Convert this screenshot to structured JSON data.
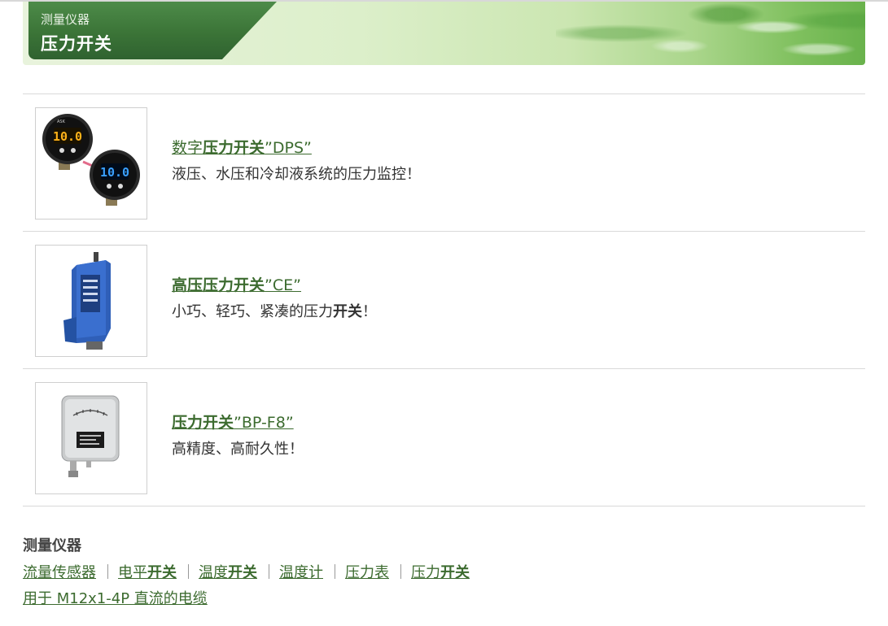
{
  "banner": {
    "category": "测量仪器",
    "title": "压力开关"
  },
  "products": [
    {
      "title_parts": [
        "数字",
        "压力",
        "开关",
        "”DPS”"
      ],
      "desc_parts": [
        "液压、水压和冷却液系统的压力监控！"
      ],
      "image": "digital-pressure-switch-dps",
      "display_value": "10.0"
    },
    {
      "title_parts": [
        "高压",
        "压力",
        "开关",
        "”CE”"
      ],
      "desc_parts": [
        "小巧、轻巧、紧凑的压力",
        "开关",
        "！"
      ],
      "image": "high-pressure-switch-ce"
    },
    {
      "title_parts": [
        "",
        "压力",
        "开关",
        "”BP-F8”"
      ],
      "desc_parts": [
        "高精度、高耐久性！"
      ],
      "image": "pressure-switch-bp-f8"
    }
  ],
  "footer": {
    "title": "测量仪器",
    "links": [
      {
        "pre": "流量传感器",
        "bold": ""
      },
      {
        "pre": "电平",
        "bold": "开关"
      },
      {
        "pre": "温度",
        "bold": "开关"
      },
      {
        "pre": "温度计",
        "bold": ""
      },
      {
        "pre": "压力表",
        "bold": ""
      },
      {
        "pre": "压力",
        "bold": "开关"
      }
    ],
    "cable_link": "用于 M12x1-4P 直流的电缆"
  },
  "colors": {
    "link_green": "#3c6b2f",
    "banner_tab": "#3b7437"
  }
}
